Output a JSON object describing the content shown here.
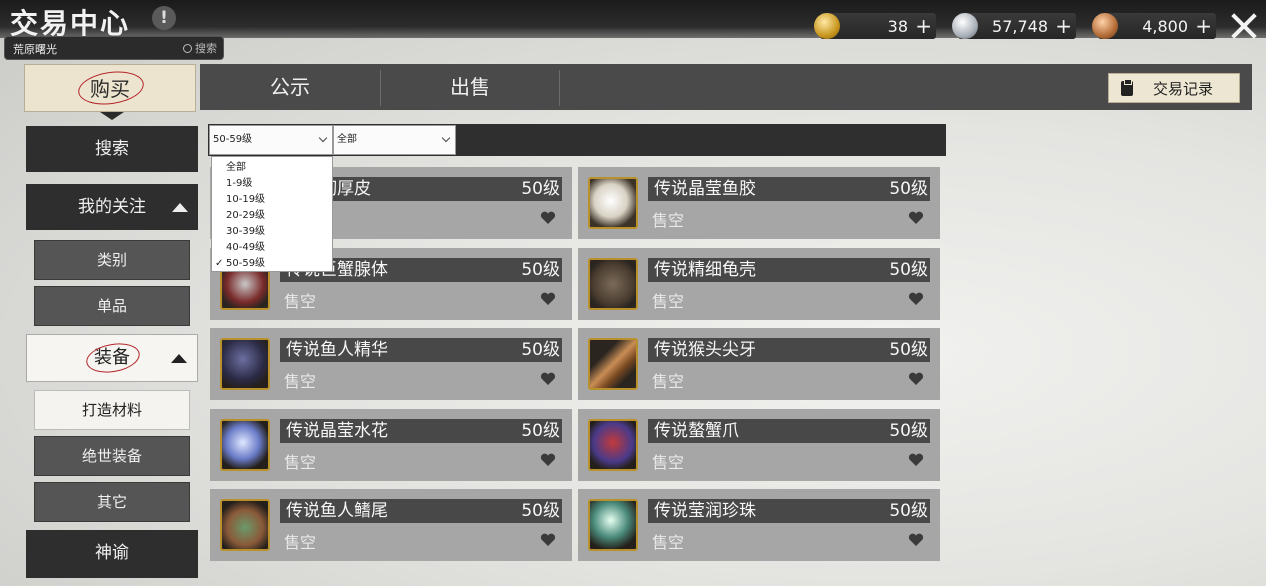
{
  "header": {
    "title": "交易中心",
    "info_icon": "!",
    "search": {
      "value": "荒原曙光",
      "button_label": "搜索"
    },
    "currencies": [
      {
        "icon": "gold-coin-icon",
        "value": "38",
        "add": "+"
      },
      {
        "icon": "silver-coin-icon",
        "value": "57,748",
        "add": "+"
      },
      {
        "icon": "bronze-coin-icon",
        "value": "4,800",
        "add": "+"
      }
    ]
  },
  "tabs": {
    "buy": "购买",
    "notice": "公示",
    "sell": "出售"
  },
  "records_button": "交易记录",
  "sidebar": {
    "search": "搜索",
    "favorites": "我的关注",
    "category": "类别",
    "single": "单品",
    "equipment": "装备",
    "crafting": "打造材料",
    "peerless": "绝世装备",
    "other": "其它",
    "oracle": "神谕"
  },
  "filters": {
    "level_select": "50-59级",
    "type_select": "全部",
    "level_options": [
      "全部",
      "1-9级",
      "10-19级",
      "20-29级",
      "30-39级",
      "40-49级",
      "50-59级"
    ],
    "selected_check": "✓"
  },
  "items": [
    {
      "name": "传说韧厚皮",
      "level": "50级",
      "status": "售空",
      "icon": "hide-icon"
    },
    {
      "name": "传说晶莹鱼胶",
      "level": "50级",
      "status": "售空",
      "icon": "fish-glue-icon"
    },
    {
      "name": "传说巨蟹腺体",
      "level": "50级",
      "status": "售空",
      "icon": "crab-gland-icon"
    },
    {
      "name": "传说精细龟壳",
      "level": "50级",
      "status": "售空",
      "icon": "turtle-shell-icon"
    },
    {
      "name": "传说鱼人精华",
      "level": "50级",
      "status": "售空",
      "icon": "murloc-essence-icon"
    },
    {
      "name": "传说猴头尖牙",
      "level": "50级",
      "status": "售空",
      "icon": "fang-icon"
    },
    {
      "name": "传说晶莹水花",
      "level": "50级",
      "status": "售空",
      "icon": "water-splash-icon"
    },
    {
      "name": "传说螯蟹爪",
      "level": "50级",
      "status": "售空",
      "icon": "crab-claw-icon"
    },
    {
      "name": "传说鱼人鳍尾",
      "level": "50级",
      "status": "售空",
      "icon": "fin-tail-icon"
    },
    {
      "name": "传说莹润珍珠",
      "level": "50级",
      "status": "售空",
      "icon": "pearl-icon"
    }
  ],
  "colors": {
    "accent_ring": "#b3242a",
    "card_bg": "#a6a6a6",
    "title_bg": "#484848",
    "icon_frame": "#b8902c"
  }
}
